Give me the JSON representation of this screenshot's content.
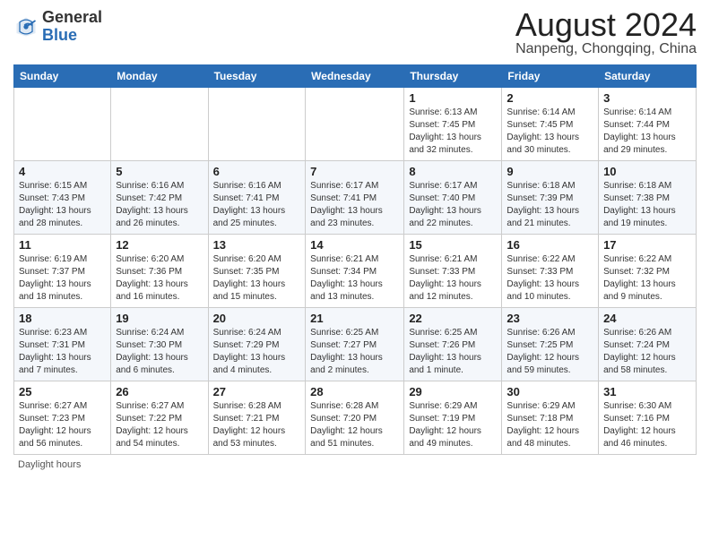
{
  "header": {
    "logo_general": "General",
    "logo_blue": "Blue",
    "month_title": "August 2024",
    "subtitle": "Nanpeng, Chongqing, China"
  },
  "days_of_week": [
    "Sunday",
    "Monday",
    "Tuesday",
    "Wednesday",
    "Thursday",
    "Friday",
    "Saturday"
  ],
  "footer": {
    "daylight_hours_label": "Daylight hours"
  },
  "weeks": [
    {
      "days": [
        {
          "number": "",
          "info": ""
        },
        {
          "number": "",
          "info": ""
        },
        {
          "number": "",
          "info": ""
        },
        {
          "number": "",
          "info": ""
        },
        {
          "number": "1",
          "info": "Sunrise: 6:13 AM\nSunset: 7:45 PM\nDaylight: 13 hours and 32 minutes."
        },
        {
          "number": "2",
          "info": "Sunrise: 6:14 AM\nSunset: 7:45 PM\nDaylight: 13 hours and 30 minutes."
        },
        {
          "number": "3",
          "info": "Sunrise: 6:14 AM\nSunset: 7:44 PM\nDaylight: 13 hours and 29 minutes."
        }
      ]
    },
    {
      "days": [
        {
          "number": "4",
          "info": "Sunrise: 6:15 AM\nSunset: 7:43 PM\nDaylight: 13 hours and 28 minutes."
        },
        {
          "number": "5",
          "info": "Sunrise: 6:16 AM\nSunset: 7:42 PM\nDaylight: 13 hours and 26 minutes."
        },
        {
          "number": "6",
          "info": "Sunrise: 6:16 AM\nSunset: 7:41 PM\nDaylight: 13 hours and 25 minutes."
        },
        {
          "number": "7",
          "info": "Sunrise: 6:17 AM\nSunset: 7:41 PM\nDaylight: 13 hours and 23 minutes."
        },
        {
          "number": "8",
          "info": "Sunrise: 6:17 AM\nSunset: 7:40 PM\nDaylight: 13 hours and 22 minutes."
        },
        {
          "number": "9",
          "info": "Sunrise: 6:18 AM\nSunset: 7:39 PM\nDaylight: 13 hours and 21 minutes."
        },
        {
          "number": "10",
          "info": "Sunrise: 6:18 AM\nSunset: 7:38 PM\nDaylight: 13 hours and 19 minutes."
        }
      ]
    },
    {
      "days": [
        {
          "number": "11",
          "info": "Sunrise: 6:19 AM\nSunset: 7:37 PM\nDaylight: 13 hours and 18 minutes."
        },
        {
          "number": "12",
          "info": "Sunrise: 6:20 AM\nSunset: 7:36 PM\nDaylight: 13 hours and 16 minutes."
        },
        {
          "number": "13",
          "info": "Sunrise: 6:20 AM\nSunset: 7:35 PM\nDaylight: 13 hours and 15 minutes."
        },
        {
          "number": "14",
          "info": "Sunrise: 6:21 AM\nSunset: 7:34 PM\nDaylight: 13 hours and 13 minutes."
        },
        {
          "number": "15",
          "info": "Sunrise: 6:21 AM\nSunset: 7:33 PM\nDaylight: 13 hours and 12 minutes."
        },
        {
          "number": "16",
          "info": "Sunrise: 6:22 AM\nSunset: 7:33 PM\nDaylight: 13 hours and 10 minutes."
        },
        {
          "number": "17",
          "info": "Sunrise: 6:22 AM\nSunset: 7:32 PM\nDaylight: 13 hours and 9 minutes."
        }
      ]
    },
    {
      "days": [
        {
          "number": "18",
          "info": "Sunrise: 6:23 AM\nSunset: 7:31 PM\nDaylight: 13 hours and 7 minutes."
        },
        {
          "number": "19",
          "info": "Sunrise: 6:24 AM\nSunset: 7:30 PM\nDaylight: 13 hours and 6 minutes."
        },
        {
          "number": "20",
          "info": "Sunrise: 6:24 AM\nSunset: 7:29 PM\nDaylight: 13 hours and 4 minutes."
        },
        {
          "number": "21",
          "info": "Sunrise: 6:25 AM\nSunset: 7:27 PM\nDaylight: 13 hours and 2 minutes."
        },
        {
          "number": "22",
          "info": "Sunrise: 6:25 AM\nSunset: 7:26 PM\nDaylight: 13 hours and 1 minute."
        },
        {
          "number": "23",
          "info": "Sunrise: 6:26 AM\nSunset: 7:25 PM\nDaylight: 12 hours and 59 minutes."
        },
        {
          "number": "24",
          "info": "Sunrise: 6:26 AM\nSunset: 7:24 PM\nDaylight: 12 hours and 58 minutes."
        }
      ]
    },
    {
      "days": [
        {
          "number": "25",
          "info": "Sunrise: 6:27 AM\nSunset: 7:23 PM\nDaylight: 12 hours and 56 minutes."
        },
        {
          "number": "26",
          "info": "Sunrise: 6:27 AM\nSunset: 7:22 PM\nDaylight: 12 hours and 54 minutes."
        },
        {
          "number": "27",
          "info": "Sunrise: 6:28 AM\nSunset: 7:21 PM\nDaylight: 12 hours and 53 minutes."
        },
        {
          "number": "28",
          "info": "Sunrise: 6:28 AM\nSunset: 7:20 PM\nDaylight: 12 hours and 51 minutes."
        },
        {
          "number": "29",
          "info": "Sunrise: 6:29 AM\nSunset: 7:19 PM\nDaylight: 12 hours and 49 minutes."
        },
        {
          "number": "30",
          "info": "Sunrise: 6:29 AM\nSunset: 7:18 PM\nDaylight: 12 hours and 48 minutes."
        },
        {
          "number": "31",
          "info": "Sunrise: 6:30 AM\nSunset: 7:16 PM\nDaylight: 12 hours and 46 minutes."
        }
      ]
    }
  ]
}
